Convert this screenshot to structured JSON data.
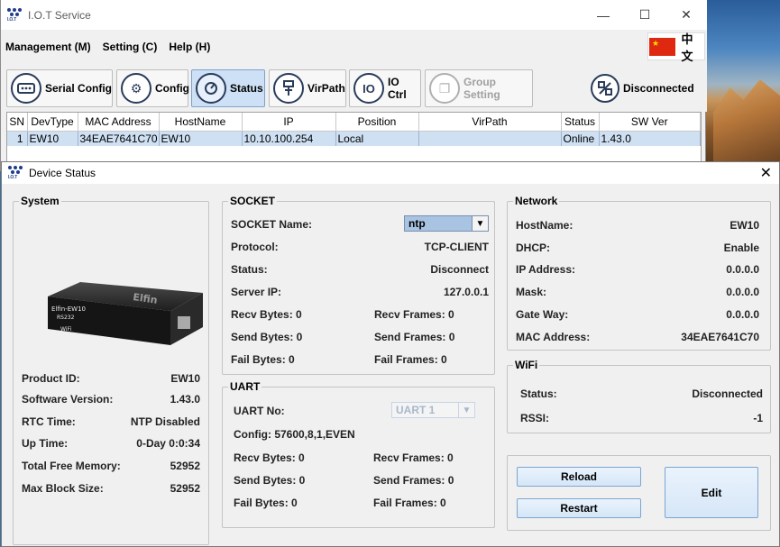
{
  "app": {
    "title": "I.O.T Service",
    "icon_text": "I.O.T"
  },
  "window_controls": {
    "minimize": "—",
    "maximize": "☐",
    "close": "✕"
  },
  "menu": {
    "items": [
      "Management (M)",
      "Setting (C)",
      "Help (H)"
    ],
    "language": "中文"
  },
  "toolbar": {
    "buttons": [
      {
        "label": "Serial Config",
        "icon": "serial-icon"
      },
      {
        "label": "Config",
        "icon": "config-icon"
      },
      {
        "label": "Status",
        "icon": "status-icon",
        "active": true
      },
      {
        "label": "VirPath",
        "icon": "virpath-icon"
      },
      {
        "label": "IO Ctrl",
        "icon": "io-ctrl-icon"
      },
      {
        "label": "Group Setting",
        "icon": "group-setting-icon",
        "disabled": true
      }
    ],
    "connection_status": "Disconnected"
  },
  "device_table": {
    "headers": [
      "SN",
      "DevType",
      "MAC Address",
      "HostName",
      "IP",
      "Position",
      "VirPath",
      "Status",
      "SW Ver"
    ],
    "rows": [
      [
        "1",
        "EW10",
        "34EAE7641C70",
        "EW10",
        "10.10.100.254",
        "Local",
        "",
        "Online",
        "1.43.0"
      ]
    ]
  },
  "dialog": {
    "title": "Device Status",
    "close": "✕",
    "system": {
      "legend": "System",
      "device_label_text": "Elfin-EW10",
      "device_subtext": "RS232",
      "device_wifi": "WiFi",
      "device_brand": "Elfin",
      "fields": [
        {
          "label": "Product ID:",
          "value": "EW10"
        },
        {
          "label": "Software Version:",
          "value": "1.43.0"
        },
        {
          "label": "RTC Time:",
          "value": "NTP Disabled"
        },
        {
          "label": "Up Time:",
          "value": "0-Day 0:0:34"
        },
        {
          "label": "Total Free Memory:",
          "value": "52952"
        },
        {
          "label": "Max Block Size:",
          "value": "52952"
        }
      ]
    },
    "socket": {
      "legend": "SOCKET",
      "name_label": "SOCKET Name:",
      "name_value": "ntp",
      "protocol_label": "Protocol:",
      "protocol_value": "TCP-CLIENT",
      "status_label": "Status:",
      "status_value": "Disconnect",
      "server_ip_label": "Server IP:",
      "server_ip_value": "127.0.0.1",
      "recv_bytes": "Recv Bytes: 0",
      "recv_frames": "Recv Frames: 0",
      "send_bytes": "Send Bytes: 0",
      "send_frames": "Send Frames: 0",
      "fail_bytes": "Fail Bytes: 0",
      "fail_frames": "Fail Frames: 0"
    },
    "uart": {
      "legend": "UART",
      "no_label": "UART No:",
      "no_value": "UART 1",
      "config": "Config: 57600,8,1,EVEN",
      "recv_bytes": "Recv Bytes: 0",
      "recv_frames": "Recv Frames: 0",
      "send_bytes": "Send Bytes: 0",
      "send_frames": "Send Frames: 0",
      "fail_bytes": "Fail Bytes: 0",
      "fail_frames": "Fail Frames: 0"
    },
    "network": {
      "legend": "Network",
      "fields": [
        {
          "label": "HostName:",
          "value": "EW10"
        },
        {
          "label": "DHCP:",
          "value": "Enable"
        },
        {
          "label": "IP Address:",
          "value": "0.0.0.0"
        },
        {
          "label": "Mask:",
          "value": "0.0.0.0"
        },
        {
          "label": "Gate Way:",
          "value": "0.0.0.0"
        },
        {
          "label": "MAC Address:",
          "value": "34EAE7641C70"
        }
      ]
    },
    "wifi": {
      "legend": "WiFi",
      "status_label": "Status:",
      "status_value": "Disconnected",
      "rssi_label": "RSSI:",
      "rssi_value": "-1"
    },
    "buttons": {
      "reload": "Reload",
      "restart": "Restart",
      "edit": "Edit"
    }
  },
  "colors": {
    "selected_row": "#cfe0f3",
    "active_tab": "#cde0f5",
    "button_border": "#7aa6d0"
  }
}
